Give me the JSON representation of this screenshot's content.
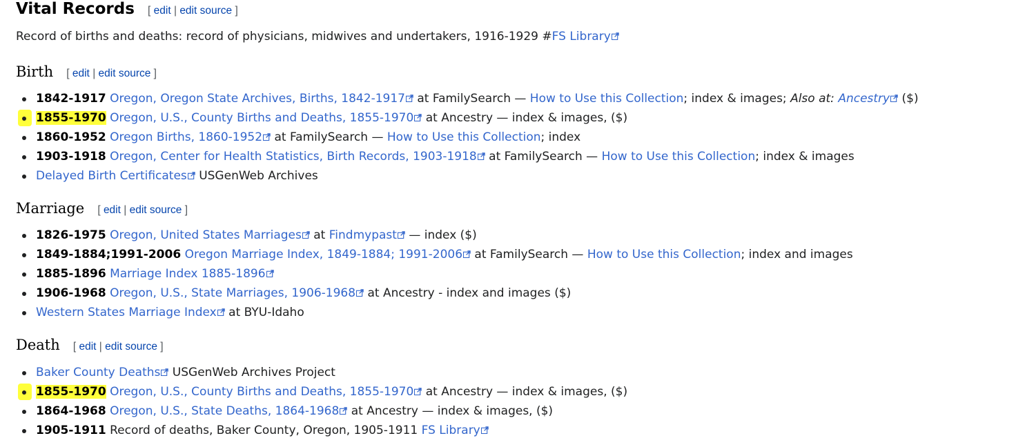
{
  "vital": {
    "title": "Vital Records",
    "edit_open": "[",
    "edit_label": "edit",
    "edit_sep": "|",
    "edit_source_label": "edit source",
    "edit_close": "]",
    "intro_text": "Record of births and deaths: record of physicians, midwives and undertakers, 1916-1929 ",
    "intro_hash": "#",
    "intro_link": "FS Library"
  },
  "birth": {
    "title": "Birth",
    "items": [
      {
        "years": "1842-1917",
        "link": "Oregon, Oregon State Archives, Births, 1842-1917",
        "t1": " at FamilySearch — ",
        "link2": "How to Use this Collection",
        "t2": "; index & images; ",
        "em": "Also at:",
        "t3": " ",
        "link3": "Ancestry",
        "t4": " ($)"
      },
      {
        "years": "1855-1970",
        "link": "Oregon, U.S., County Births and Deaths, 1855-1970",
        "t1": " at Ancestry — index & images, ($)"
      },
      {
        "years": "1860-1952",
        "link": "Oregon Births, 1860-1952",
        "t1": " at FamilySearch — ",
        "link2": "How to Use this Collection",
        "t2": "; index"
      },
      {
        "years": "1903-1918",
        "link": "Oregon, Center for Health Statistics, Birth Records, 1903-1918",
        "t1": " at FamilySearch — ",
        "link2": "How to Use this Collection",
        "t2": "; index & images"
      },
      {
        "link": "Delayed Birth Certificates",
        "t1": " USGenWeb Archives"
      }
    ]
  },
  "marriage": {
    "title": "Marriage",
    "items": [
      {
        "years": "1826-1975",
        "link": "Oregon, United States Marriages",
        "t1": " at ",
        "link2": "Findmypast",
        "t2": " — index ($)"
      },
      {
        "years": "1849-1884;1991-2006",
        "link": "Oregon Marriage Index, 1849-1884; 1991-2006",
        "t1": " at FamilySearch — ",
        "link2": "How to Use this Collection",
        "t2": "; index and images"
      },
      {
        "years": "1885-1896",
        "link": "Marriage Index 1885-1896"
      },
      {
        "years": "1906-1968",
        "link": "Oregon, U.S., State Marriages, 1906-1968",
        "t1": " at Ancestry - index and images ($)"
      },
      {
        "link": "Western States Marriage Index",
        "t1": " at BYU-Idaho"
      }
    ]
  },
  "death": {
    "title": "Death",
    "items": [
      {
        "link": "Baker County Deaths",
        "t1": " USGenWeb Archives Project"
      },
      {
        "years": "1855-1970",
        "link": "Oregon, U.S., County Births and Deaths, 1855-1970",
        "t1": " at Ancestry — index & images, ($)"
      },
      {
        "years": "1864-1968",
        "link": "Oregon, U.S., State Deaths, 1864-1968",
        "t1": " at Ancestry — index & images, ($)"
      },
      {
        "years": "1905-1911",
        "t0": " Record of deaths, Baker County, Oregon, 1905-1911 ",
        "link": "FS Library"
      }
    ]
  },
  "colors": {
    "link": "#3366cc",
    "highlight": "#ffff3b",
    "text": "#202122"
  },
  "icons": {
    "external": "external-link-icon"
  }
}
